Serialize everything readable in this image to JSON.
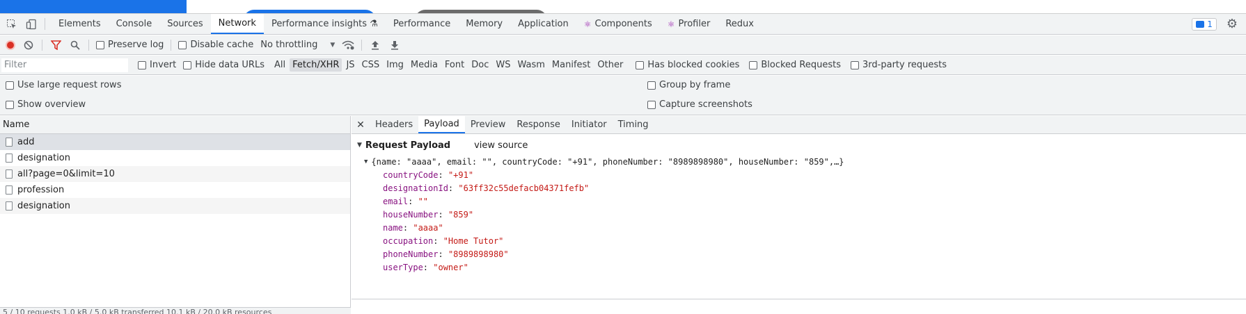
{
  "devtools_tabs": [
    {
      "label": "Elements",
      "active": false,
      "icon": ""
    },
    {
      "label": "Console",
      "active": false,
      "icon": ""
    },
    {
      "label": "Sources",
      "active": false,
      "icon": ""
    },
    {
      "label": "Network",
      "active": true,
      "icon": ""
    },
    {
      "label": "Performance insights ⚗",
      "active": false,
      "icon": ""
    },
    {
      "label": "Performance",
      "active": false,
      "icon": ""
    },
    {
      "label": "Memory",
      "active": false,
      "icon": ""
    },
    {
      "label": "Application",
      "active": false,
      "icon": ""
    },
    {
      "label": "Components",
      "active": false,
      "icon": "⚛"
    },
    {
      "label": "Profiler",
      "active": false,
      "icon": "⚛"
    },
    {
      "label": "Redux",
      "active": false,
      "icon": ""
    }
  ],
  "issues_badge": {
    "count": "1"
  },
  "network_toolbar": {
    "preserve_log": "Preserve log",
    "disable_cache": "Disable cache",
    "throttling": "No throttling"
  },
  "filter_row": {
    "placeholder": "Filter",
    "invert": "Invert",
    "hide_data_urls": "Hide data URLs",
    "types": [
      "All",
      "Fetch/XHR",
      "JS",
      "CSS",
      "Img",
      "Media",
      "Font",
      "Doc",
      "WS",
      "Wasm",
      "Manifest",
      "Other"
    ],
    "selected_type": "Fetch/XHR",
    "has_blocked_cookies": "Has blocked cookies",
    "blocked_requests": "Blocked Requests",
    "third_party": "3rd-party requests"
  },
  "options": {
    "large_rows": "Use large request rows",
    "show_overview": "Show overview",
    "group_by_frame": "Group by frame",
    "capture_screenshots": "Capture screenshots"
  },
  "requests": {
    "header": "Name",
    "items": [
      {
        "name": "add",
        "selected": true
      },
      {
        "name": "designation",
        "selected": false
      },
      {
        "name": "all?page=0&limit=10",
        "selected": false
      },
      {
        "name": "profession",
        "selected": false
      },
      {
        "name": "designation",
        "selected": false
      }
    ],
    "status": "5 / 10 requests   1.0 kB / 5.0 kB transferred   10.1 kB / 20.0 kB resources"
  },
  "detail": {
    "tabs": [
      {
        "label": "Headers",
        "active": false
      },
      {
        "label": "Payload",
        "active": true
      },
      {
        "label": "Preview",
        "active": false
      },
      {
        "label": "Response",
        "active": false
      },
      {
        "label": "Initiator",
        "active": false
      },
      {
        "label": "Timing",
        "active": false
      }
    ],
    "payload_title": "Request Payload",
    "view_source": "view source",
    "summary": "{name: \"aaaa\", email: \"\", countryCode: \"+91\", phoneNumber: \"8989898980\", houseNumber: \"859\",…}",
    "fields": [
      {
        "key": "countryCode",
        "value": "\"+91\""
      },
      {
        "key": "designationId",
        "value": "\"63ff32c55defacb04371fefb\""
      },
      {
        "key": "email",
        "value": "\"\""
      },
      {
        "key": "houseNumber",
        "value": "\"859\""
      },
      {
        "key": "name",
        "value": "\"aaaa\""
      },
      {
        "key": "occupation",
        "value": "\"Home Tutor\""
      },
      {
        "key": "phoneNumber",
        "value": "\"8989898980\""
      },
      {
        "key": "userType",
        "value": "\"owner\""
      }
    ]
  }
}
